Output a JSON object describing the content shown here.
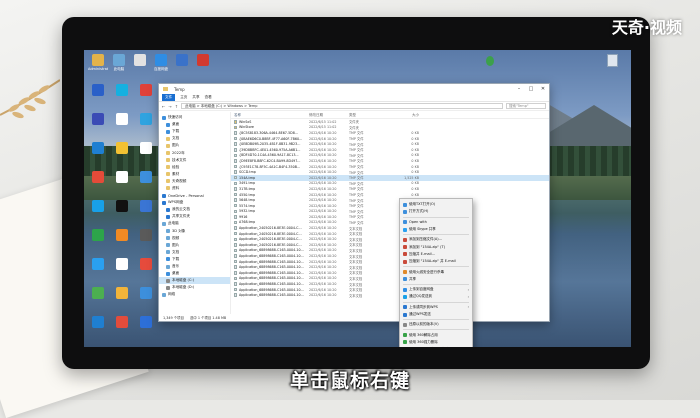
{
  "watermark": "天奇·视频",
  "subtitle": "单击鼠标右键",
  "desktop": {
    "top_icons": [
      {
        "label": "Administrator",
        "color": "#e3b34a"
      },
      {
        "label": "此电脑",
        "color": "#6aa7d6"
      },
      {
        "label": "",
        "color": "#e2e2e2"
      },
      {
        "label": "百度网盘",
        "color": "#2f8de4"
      },
      {
        "label": "",
        "color": "#3a72c9"
      },
      {
        "label": "",
        "color": "#d23a2f"
      }
    ],
    "left_icons": [
      {
        "label": "",
        "color": "#2a60c8"
      },
      {
        "label": "",
        "color": "#15b0e0"
      },
      {
        "label": "",
        "color": "#e0413a"
      },
      {
        "label": "",
        "color": "#3b4bb5"
      },
      {
        "label": "",
        "color": "#ffffff"
      },
      {
        "label": "",
        "color": "#2fa3e0"
      },
      {
        "label": "",
        "color": "#1f7fd1"
      },
      {
        "label": "",
        "color": "#f2c133"
      },
      {
        "label": "",
        "color": "#ffffff"
      },
      {
        "label": "",
        "color": "#e44b39"
      },
      {
        "label": "",
        "color": "#ffffff"
      },
      {
        "label": "",
        "color": "#3d8fdc"
      },
      {
        "label": "",
        "color": "#18a0e8"
      },
      {
        "label": "",
        "color": "#111111"
      },
      {
        "label": "",
        "color": "#3a75d4"
      },
      {
        "label": "",
        "color": "#2da44a"
      },
      {
        "label": "",
        "color": "#f08a24"
      },
      {
        "label": "",
        "color": "#5a5a5a"
      },
      {
        "label": "",
        "color": "#2aa0f0"
      },
      {
        "label": "",
        "color": "#ffffff"
      },
      {
        "label": "",
        "color": "#e64b3c"
      },
      {
        "label": "",
        "color": "#4caf50"
      },
      {
        "label": "",
        "color": "#f2b43a"
      },
      {
        "label": "",
        "color": "#3d8fdc"
      },
      {
        "label": "",
        "color": "#1f7fd1"
      },
      {
        "label": "",
        "color": "#e24c3c"
      },
      {
        "label": "",
        "color": "#2d6fd8"
      }
    ],
    "recycle_bin": ""
  },
  "explorer": {
    "title": "Temp",
    "ribbon_tabs": [
      "文件",
      "主页",
      "共享",
      "查看"
    ],
    "path": "此电脑 > 本地磁盘 (C:) > Windows > Temp",
    "search_placeholder": "搜索\"Temp\"",
    "nav_items": [
      {
        "label": "快速访问",
        "color": "#3d8fdc",
        "indent": false
      },
      {
        "label": "桌面",
        "color": "#3d8fdc",
        "indent": true
      },
      {
        "label": "下载",
        "color": "#3d8fdc",
        "indent": true
      },
      {
        "label": "文档",
        "color": "#e8c56a",
        "indent": true
      },
      {
        "label": "图片",
        "color": "#e8c56a",
        "indent": true
      },
      {
        "label": "2022年",
        "color": "#e8c56a",
        "indent": true
      },
      {
        "label": "技术文件",
        "color": "#e8c56a",
        "indent": true
      },
      {
        "label": "经验",
        "color": "#e8c56a",
        "indent": true
      },
      {
        "label": "素材",
        "color": "#e8c56a",
        "indent": true
      },
      {
        "label": "天奇视频",
        "color": "#e8c56a",
        "indent": true
      },
      {
        "label": "资料",
        "color": "#e8c56a",
        "indent": true
      },
      {
        "label": "OneDrive - Personal",
        "color": "#2a78d0",
        "indent": false
      },
      {
        "label": "WPS网盘",
        "color": "#2a78d0",
        "indent": false
      },
      {
        "label": "我的云文档",
        "color": "#2a78d0",
        "indent": true
      },
      {
        "label": "共享文件夹",
        "color": "#2a78d0",
        "indent": true
      },
      {
        "label": "此电脑",
        "color": "#6aa7d6",
        "indent": false
      },
      {
        "label": "3D 对象",
        "color": "#6aa7d6",
        "indent": true
      },
      {
        "label": "视频",
        "color": "#6aa7d6",
        "indent": true
      },
      {
        "label": "图片",
        "color": "#6aa7d6",
        "indent": true
      },
      {
        "label": "文档",
        "color": "#6aa7d6",
        "indent": true
      },
      {
        "label": "下载",
        "color": "#3d8fdc",
        "indent": true
      },
      {
        "label": "音乐",
        "color": "#6aa7d6",
        "indent": true
      },
      {
        "label": "桌面",
        "color": "#3d8fdc",
        "indent": true
      },
      {
        "label": "本地磁盘 (C:)",
        "color": "#888888",
        "indent": true,
        "selected": true
      },
      {
        "label": "本地磁盘 (D:)",
        "color": "#888888",
        "indent": true
      },
      {
        "label": "网络",
        "color": "#6aa7d6",
        "indent": false
      }
    ],
    "columns": [
      "名称",
      "修改日期",
      "类型",
      "大小"
    ],
    "rows": [
      {
        "name": "WinSxS",
        "date": "2022/6/15 11:02",
        "type": "文件夹",
        "size": ""
      },
      {
        "name": "WinStore",
        "date": "2022/6/15 11:02",
        "type": "文件夹",
        "size": ""
      },
      {
        "name": "{8C5S8183-306A-4464-8E67-5D8...",
        "date": "2022/6/16 10:20",
        "type": "TMP 文件",
        "size": "0 KB"
      },
      {
        "name": "{0BAE6D6C0-B8BF-4F77-A60F-7B60...",
        "date": "2022/6/16 10:20",
        "type": "TMP 文件",
        "size": "0 KB"
      },
      {
        "name": "{0E8DB09B-2035-4B1F-8B31-9B23...",
        "date": "2022/6/16 10:20",
        "type": "TMP 文件",
        "size": "0 KB"
      },
      {
        "name": "{39D8BBFC-4E01-4560-975A-A6B1...",
        "date": "2022/6/16 10:20",
        "type": "TMP 文件",
        "size": "0 KB"
      },
      {
        "name": "{8DF4D70-1C4A-4560-9A17-8C13...",
        "date": "2022/6/16 10:20",
        "type": "TMP 文件",
        "size": "0 KB"
      },
      {
        "name": "{D9EE8F8-B8FC-62C4-BA99-8D497...",
        "date": "2022/6/16 10:20",
        "type": "TMP 文件",
        "size": "0 KB"
      },
      {
        "name": "{C93E1C78-8F5C-4A1C-B4F4-350B...",
        "date": "2022/6/16 10:20",
        "type": "TMP 文件",
        "size": "0 KB"
      },
      {
        "name": "SCCD.tmp",
        "date": "2022/6/16 10:20",
        "type": "TMP 文件",
        "size": "0 KB"
      },
      {
        "name": "154A.tmp",
        "date": "2022/6/16 10:20",
        "type": "TMP 文件",
        "size": "1,525 KB",
        "selected": true
      },
      {
        "name": "3491.tmp",
        "date": "2022/6/16 10:20",
        "type": "TMP 文件",
        "size": "0 KB"
      },
      {
        "name": "317B.tmp",
        "date": "2022/6/16 10:20",
        "type": "TMP 文件",
        "size": "0 KB"
      },
      {
        "name": "4550.tmp",
        "date": "2022/6/16 10:20",
        "type": "TMP 文件",
        "size": "0 KB"
      },
      {
        "name": "5648.tmp",
        "date": "2022/6/16 10:20",
        "type": "TMP 文件",
        "size": "0 KB"
      },
      {
        "name": "5574.tmp",
        "date": "2022/6/16 10:20",
        "type": "TMP 文件",
        "size": "0 KB"
      },
      {
        "name": "5932.tmp",
        "date": "2022/6/16 10:20",
        "type": "TMP 文件",
        "size": "0 KB"
      },
      {
        "name": "9916",
        "date": "2022/6/16 10:20",
        "type": "TMP 文件",
        "size": "0 KB"
      },
      {
        "name": "A768.tmp",
        "date": "2022/6/16 10:20",
        "type": "TMP 文件",
        "size": "0 KB"
      },
      {
        "name": "Application_24050216-8E3E-0004-C...",
        "date": "2022/6/16 10:20",
        "type": "文本文档",
        "size": "22,000 KB"
      },
      {
        "name": "Application_24050216-8E3E-0004-C...",
        "date": "2022/6/16 10:20",
        "type": "文本文档",
        "size": "22,000 KB"
      },
      {
        "name": "Application_24050216-8E3E-0004-C...",
        "date": "2022/6/16 10:20",
        "type": "文本文档",
        "size": "22,000 KB"
      },
      {
        "name": "Application_24050216-8E3E-0004-C...",
        "date": "2022/6/16 10:20",
        "type": "文本文档",
        "size": "22,000 KB"
      },
      {
        "name": "Application_68898688-C163-0004-10...",
        "date": "2022/6/16 10:20",
        "type": "文本文档",
        "size": "22,000 KB"
      },
      {
        "name": "Application_68898688-C163-0004-10...",
        "date": "2022/6/16 10:20",
        "type": "文本文档",
        "size": "22,000 KB"
      },
      {
        "name": "Application_68898688-C163-0004-10...",
        "date": "2022/6/16 10:20",
        "type": "文本文档",
        "size": "22,000 KB"
      },
      {
        "name": "Application_68898688-C163-0004-10...",
        "date": "2022/6/16 10:20",
        "type": "文本文档",
        "size": "22,000 KB"
      },
      {
        "name": "Application_68898688-C163-0004-10...",
        "date": "2022/6/16 10:20",
        "type": "文本文档",
        "size": "22,000 KB"
      },
      {
        "name": "Application_68898688-C163-0004-10...",
        "date": "2022/6/16 10:20",
        "type": "文本文档",
        "size": "22,000 KB"
      },
      {
        "name": "Application_68898688-C163-0004-10...",
        "date": "2022/6/16 10:20",
        "type": "文本文档",
        "size": "22,000 KB"
      },
      {
        "name": "Application_68898688-C163-0004-10...",
        "date": "2022/6/16 10:20",
        "type": "文本文档",
        "size": "22,000 KB"
      },
      {
        "name": "Application_68898688-C163-0004-10...",
        "date": "2022/6/16 10:20",
        "type": "文本文档",
        "size": "22,000 KB"
      }
    ],
    "status_items": "1,349 个项目",
    "status_selected": "选中 1 个项目  1.48 MB"
  },
  "context_menu": {
    "items": [
      {
        "label": "使用TXT打开(O)",
        "color": "#3d8fdc",
        "arrow": false
      },
      {
        "label": "打开方式(H)",
        "color": "#3d8fdc",
        "arrow": false
      },
      {
        "label": "",
        "divider": true
      },
      {
        "label": "Open with",
        "color": "#3d8fdc",
        "arrow": false
      },
      {
        "label": "使用 Skype 共享",
        "color": "#2aa0f0",
        "arrow": false
      },
      {
        "label": "",
        "divider": true
      },
      {
        "label": "添加到压缩文件(A)...",
        "color": "#c94a3a",
        "arrow": false
      },
      {
        "label": "添加到 \"154A.zip\" (T)",
        "color": "#c94a3a",
        "arrow": false
      },
      {
        "label": "压缩并 E-mail...",
        "color": "#c94a3a",
        "arrow": false
      },
      {
        "label": "压缩到 \"154A.zip\" 并 E-mail",
        "color": "#c94a3a",
        "arrow": false
      },
      {
        "label": "",
        "divider": true
      },
      {
        "label": "使用火绒安全进行杀毒",
        "color": "#e08a2a",
        "arrow": false
      },
      {
        "label": "共享",
        "color": "#3d8fdc",
        "arrow": false
      },
      {
        "label": "",
        "divider": true
      },
      {
        "label": "上传到百度网盘",
        "color": "#2f8de4",
        "arrow": true
      },
      {
        "label": "通过QQ发送到",
        "color": "#18a0e8",
        "arrow": true
      },
      {
        "label": "",
        "divider": true
      },
      {
        "label": "上传或同步到WPS",
        "color": "#2a78d0",
        "arrow": true
      },
      {
        "label": "通过WPS发送",
        "color": "#2a78d0",
        "arrow": false
      },
      {
        "label": "",
        "divider": true
      },
      {
        "label": "还原以前的版本(V)",
        "color": "#888888",
        "arrow": false
      },
      {
        "label": "",
        "divider": true
      },
      {
        "label": "使用 360解除占用",
        "color": "#38a348",
        "arrow": false
      },
      {
        "label": "使用 360强力删除",
        "color": "#38a348",
        "arrow": false
      },
      {
        "label": "使用 360进行木马云查杀",
        "color": "#38a348",
        "arrow": false
      },
      {
        "label": "使用 360管理右键菜单",
        "color": "#38a348",
        "arrow": false
      },
      {
        "label": "",
        "divider": true
      },
      {
        "label": "发送到(N)",
        "color": "#888888",
        "arrow": true
      },
      {
        "label": "",
        "divider": true
      },
      {
        "label": "剪切(T)",
        "color": "#888888",
        "arrow": false
      },
      {
        "label": "复制(C)",
        "color": "#888888",
        "arrow": false
      },
      {
        "label": "",
        "divider": true
      },
      {
        "label": "创建快捷方式(S)",
        "color": "#888888",
        "arrow": false
      },
      {
        "label": "删除(D)",
        "color": "#888888",
        "arrow": false
      },
      {
        "label": "重命名(M)",
        "color": "#888888",
        "arrow": false
      },
      {
        "label": "",
        "divider": true
      },
      {
        "label": "属性(R)",
        "color": "#888888",
        "arrow": false
      }
    ]
  }
}
